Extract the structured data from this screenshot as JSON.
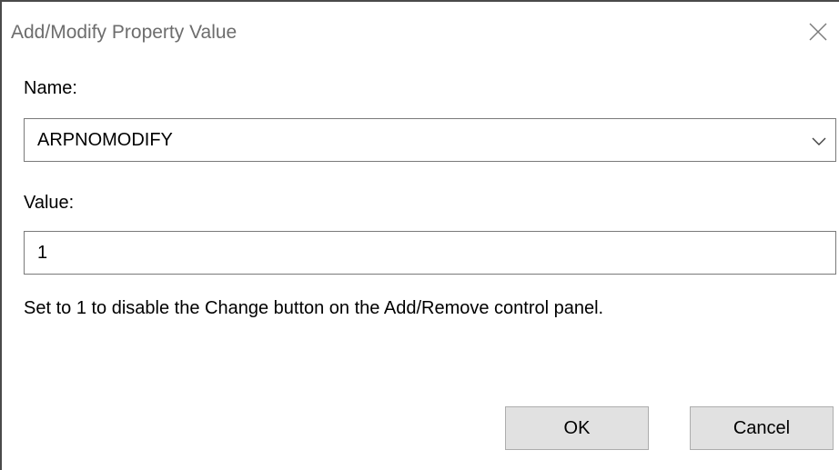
{
  "window": {
    "title": "Add/Modify Property Value",
    "close_icon": "close-icon"
  },
  "form": {
    "name_label": "Name:",
    "name_value": "ARPNOMODIFY",
    "name_dropdown_icon": "chevron-down-icon",
    "value_label": "Value:",
    "value_value": "1",
    "description": "Set to 1 to disable the Change button on the Add/Remove control panel."
  },
  "buttons": {
    "ok_label": "OK",
    "cancel_label": "Cancel"
  },
  "colors": {
    "title_text": "#6d6d6d",
    "button_bg": "#e1e1e1",
    "field_border": "#7a7a7a"
  }
}
